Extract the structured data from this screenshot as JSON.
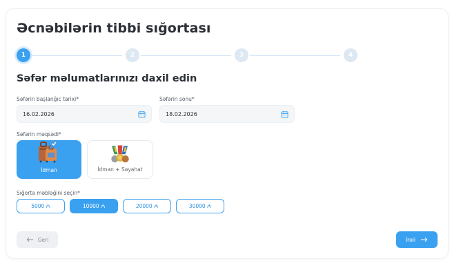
{
  "page": {
    "title": "Əcnəbilərin tibbi sığortası",
    "subtitle": "Səfər məlumatlarınızı daxil edin"
  },
  "stepper": {
    "steps": [
      "1",
      "2",
      "3",
      "4"
    ],
    "active_step": 1
  },
  "dates": {
    "start_label": "Səfərin başlanğıc tarixi*",
    "start_value": "16.02.2026",
    "end_label": "Səfərin sonu*",
    "end_value": "18.02.2026",
    "icon": "calendar-icon"
  },
  "purpose": {
    "label": "Səfərin məqsədi*",
    "options": [
      {
        "label": "İdman",
        "icon": "luggage-icon",
        "selected": true
      },
      {
        "label": "İdman + Səyahat",
        "icon": "medals-icon",
        "selected": false
      }
    ]
  },
  "amount": {
    "label": "Sığorta məbləğini seçin*",
    "options": [
      "5000 ₼",
      "10000 ₼",
      "20000 ₼",
      "30000 ₼"
    ],
    "selected_index": 1
  },
  "nav": {
    "back_label": "Geri",
    "next_label": "İrəli"
  },
  "colors": {
    "accent": "#3aa0f0",
    "step_inactive": "#dde8f3"
  }
}
